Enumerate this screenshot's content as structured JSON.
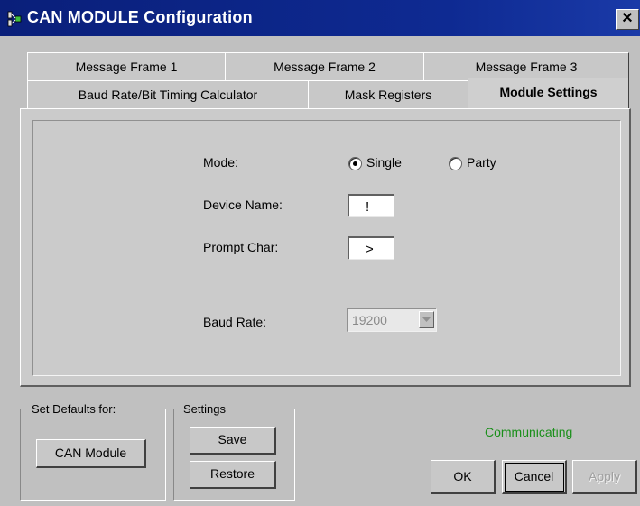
{
  "window": {
    "title": "CAN MODULE Configuration",
    "close_glyph": "✕"
  },
  "tabs_row1": [
    "Message Frame 1",
    "Message Frame 2",
    "Message Frame 3"
  ],
  "tabs_row2": [
    "Baud Rate/Bit Timing Calculator",
    "Mask Registers",
    "Module Settings"
  ],
  "active_tab": "Module Settings",
  "settings": {
    "mode_label": "Mode:",
    "mode_options": [
      "Single",
      "Party"
    ],
    "mode_selected": "Single",
    "device_name_label": "Device Name:",
    "device_name_value": "!",
    "prompt_char_label": "Prompt Char:",
    "prompt_char_value": ">",
    "baud_rate_label": "Baud Rate:",
    "baud_rate_value": "19200"
  },
  "defaults_group": {
    "title": "Set Defaults for:",
    "button": "CAN Module"
  },
  "settings_group": {
    "title": "Settings",
    "save": "Save",
    "restore": "Restore"
  },
  "status": {
    "text": "Communicating",
    "color": "#1a8f1a"
  },
  "dialog_buttons": {
    "ok": "OK",
    "cancel": "Cancel",
    "apply": "Apply"
  },
  "icons": {
    "app": "network-plug-icon",
    "combo": "chevron-down-icon"
  }
}
